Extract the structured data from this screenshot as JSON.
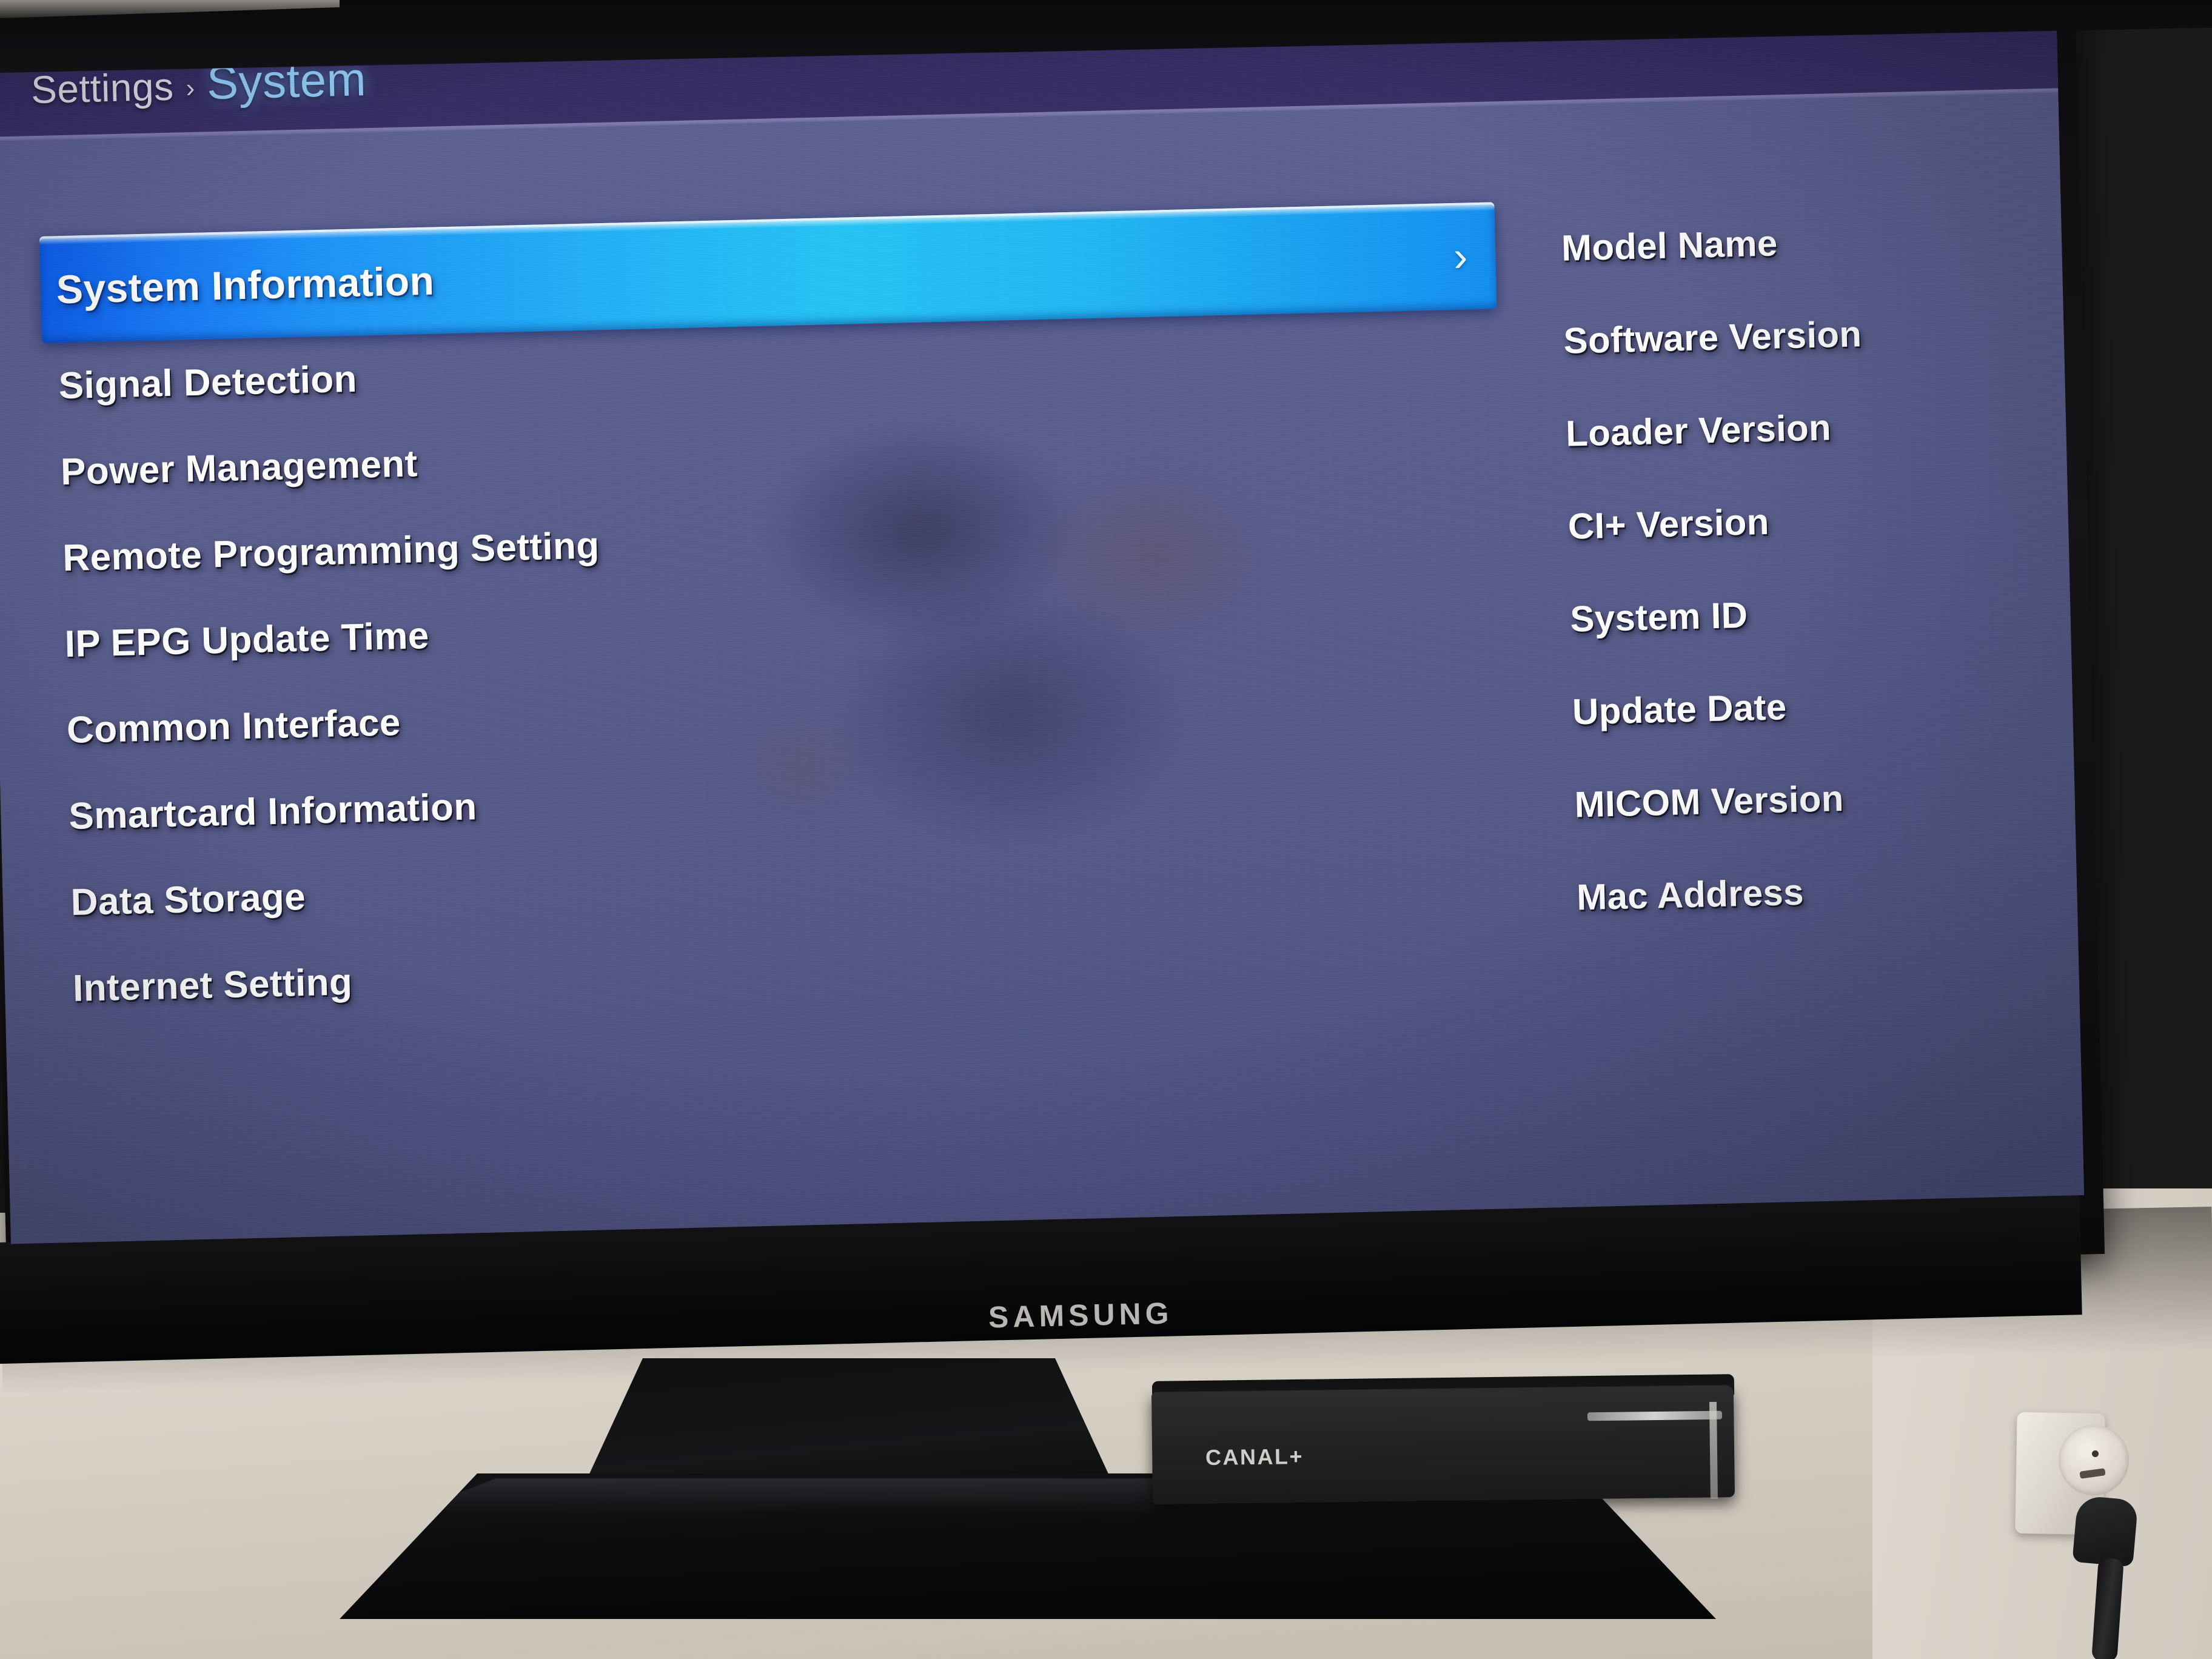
{
  "screen": {
    "header": {
      "breadcrumb_root": "Settings",
      "breadcrumb_separator": "›",
      "breadcrumb_current": "System"
    },
    "menu": {
      "items": [
        {
          "label": "System Information",
          "selected": true,
          "chevron": "›"
        },
        {
          "label": "Signal Detection",
          "selected": false
        },
        {
          "label": "Power Management",
          "selected": false
        },
        {
          "label": "Remote Programming Setting",
          "selected": false
        },
        {
          "label": "IP EPG Update Time",
          "selected": false
        },
        {
          "label": "Common Interface",
          "selected": false
        },
        {
          "label": "Smartcard Information",
          "selected": false
        },
        {
          "label": "Data Storage",
          "selected": false
        },
        {
          "label": "Internet Setting",
          "selected": false
        }
      ]
    },
    "info_panel": {
      "items": [
        {
          "label": "Model Name"
        },
        {
          "label": "Software Version"
        },
        {
          "label": "Loader Version"
        },
        {
          "label": "CI+ Version"
        },
        {
          "label": "System ID"
        },
        {
          "label": "Update Date"
        },
        {
          "label": "MICOM Version"
        },
        {
          "label": "Mac Address"
        }
      ]
    },
    "colors": {
      "panel_background": "#595e8d",
      "header_background": "#332a5f",
      "highlight_start": "#0c5ff0",
      "highlight_end": "#25c5f6",
      "breadcrumb_current": "#8fc9f5",
      "text": "#ffffff"
    }
  },
  "hardware": {
    "tv_brand": "SAMSUNG",
    "set_top_box_brand": "CANAL+"
  }
}
